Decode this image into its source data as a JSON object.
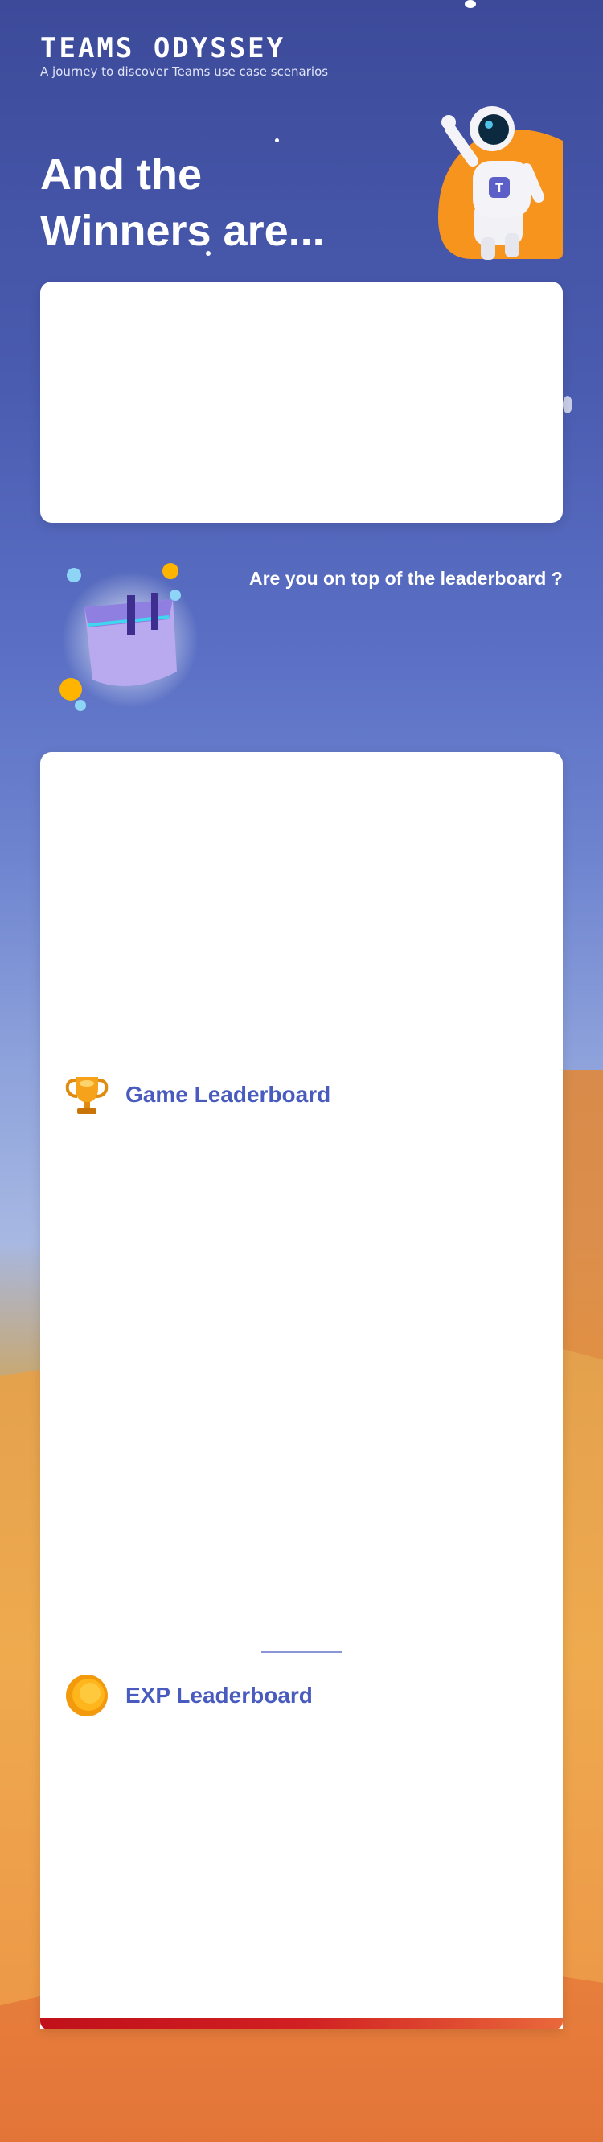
{
  "brand": {
    "title": "TEAMS ODYSSEY",
    "subtitle": "A journey to discover Teams use case scenarios"
  },
  "hero": {
    "title": "And the Winners are..."
  },
  "leaderboard_prompt": "Are you on top of the leaderboard ?",
  "sections": {
    "game": {
      "label": "Game Leaderboard",
      "icon": "trophy-icon"
    },
    "exp": {
      "label": "EXP Leaderboard",
      "icon": "coin-icon"
    }
  },
  "colors": {
    "accent": "#4a5bc0",
    "bottom_bar": "#d11f22",
    "astronaut_badge": "#f7941d"
  }
}
